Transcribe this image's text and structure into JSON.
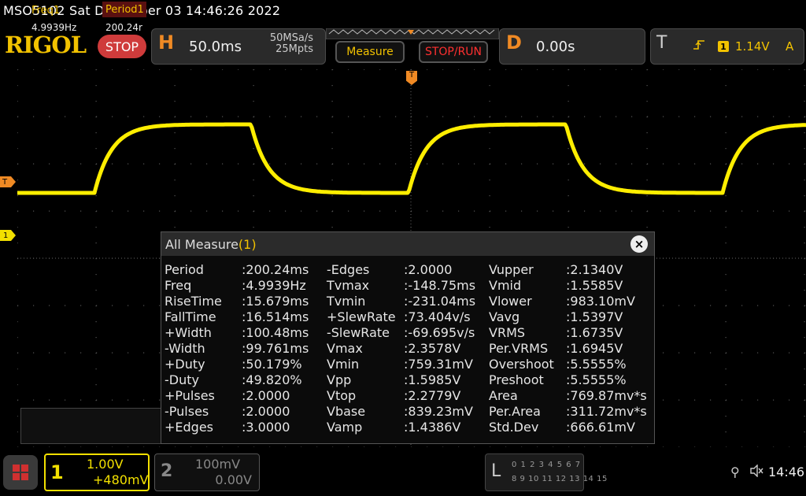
{
  "header": {
    "title": "MSO5102  Sat December 03 14:46:26 2022",
    "brand": "RIGOL",
    "run_state": "STOP",
    "horizontal": {
      "letter": "H",
      "timebase": "50.0ms",
      "sample_rate": "50MSa/s",
      "memory_depth": "25Mpts"
    },
    "measure_label": "Measure",
    "stoprun_label": "STOP/RUN",
    "delay": {
      "letter": "D",
      "value": "0.00s"
    },
    "trigger": {
      "letter": "T",
      "edge_icon": "rising-edge-icon",
      "channel": "1",
      "level": "1.14V",
      "mode": "A"
    }
  },
  "markers": {
    "trigger_level": "T",
    "channel1": "1",
    "trigger_position": "T"
  },
  "measure": {
    "title": "All Measure",
    "channel": "(1)",
    "close_label": "×",
    "rows": [
      [
        "Period",
        ":200.24ms",
        "-Edges",
        ":2.0000",
        "Vupper",
        ":2.1340V"
      ],
      [
        "Freq",
        ":4.9939Hz",
        "Tvmax",
        ":-148.75ms",
        "Vmid",
        ":1.5585V"
      ],
      [
        "RiseTime",
        ":15.679ms",
        "Tvmin",
        ":-231.04ms",
        "Vlower",
        ":983.10mV"
      ],
      [
        "FallTime",
        ":16.514ms",
        "+SlewRate",
        ":73.404v/s",
        "Vavg",
        ":1.5397V"
      ],
      [
        "+Width",
        ":100.48ms",
        "-SlewRate",
        ":-69.695v/s",
        "VRMS",
        ":1.6735V"
      ],
      [
        "-Width",
        ":99.761ms",
        "Vmax",
        ":2.3578V",
        "Per.VRMS",
        ":1.6945V"
      ],
      [
        "+Duty",
        ":50.179%",
        "Vmin",
        ":759.31mV",
        "Overshoot",
        ":5.5555%"
      ],
      [
        "-Duty",
        ":49.820%",
        "Vpp",
        ":1.5985V",
        "Preshoot",
        ":5.5555%"
      ],
      [
        "+Pulses",
        ":2.0000",
        "Vtop",
        ":2.2779V",
        "Area",
        ":769.87mv*s"
      ],
      [
        "-Pulses",
        ":2.0000",
        "Vbase",
        ":839.23mV",
        "Per.Area",
        ":311.72mv*s"
      ],
      [
        "+Edges",
        ":3.0000",
        "Vamp",
        ":1.4386V",
        "Std.Dev",
        ":666.61mV"
      ]
    ]
  },
  "counter": {
    "head1": "Freq1",
    "head2": "Period1",
    "val1": "4.9939Hz",
    "val2": "200.24r"
  },
  "channels": {
    "ch1": {
      "num": "1",
      "scale": "1.00V",
      "offset": "+480mV",
      "color": "#f2e000"
    },
    "ch2": {
      "num": "2",
      "scale": "100mV",
      "offset": "0.00V"
    }
  },
  "la": {
    "letter": "L",
    "row1": "0 1 2 3  4 5 6 7",
    "row2": "8 9 10 11 12 13 14 15"
  },
  "status": {
    "clock": "14:46",
    "usb_icon": "usb-icon",
    "speaker_icon": "speaker-muted-icon"
  },
  "colors": {
    "trace": "#ffee00",
    "accent_orange": "#f08a24",
    "brand_yellow": "#f2c200",
    "stop_red": "#cf3b3b"
  }
}
